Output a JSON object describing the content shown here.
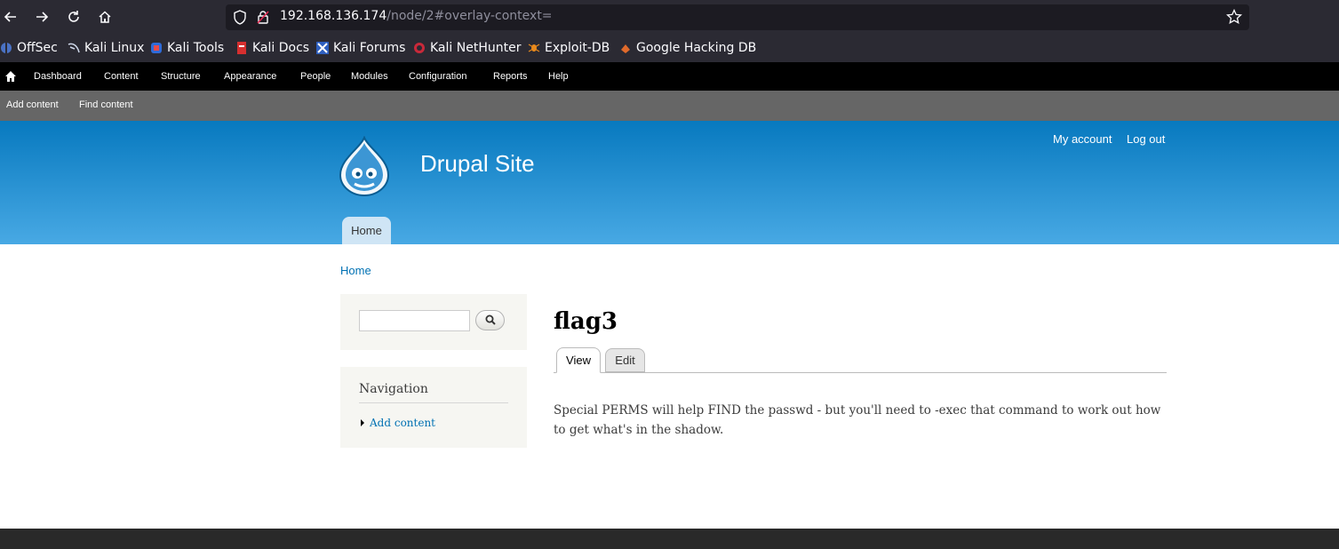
{
  "browser": {
    "url_host": "192.168.136.174",
    "url_path": "/node/2#overlay-context=",
    "bookmarks": [
      "OffSec",
      "Kali Linux",
      "Kali Tools",
      "Kali Docs",
      "Kali Forums",
      "Kali NetHunter",
      "Exploit-DB",
      "Google Hacking DB"
    ],
    "icons": {
      "back": "back-arrow-icon",
      "forward": "forward-arrow-icon",
      "reload": "reload-icon",
      "home": "home-icon",
      "shield": "shield-icon",
      "lock": "insecure-lock-icon",
      "star": "bookmark-star-icon"
    }
  },
  "toolbar": {
    "items": [
      "Dashboard",
      "Content",
      "Structure",
      "Appearance",
      "People",
      "Modules",
      "Configuration",
      "Reports",
      "Help"
    ],
    "shortcuts": [
      "Add content",
      "Find content"
    ]
  },
  "header": {
    "site_name": "Drupal Site",
    "secondary_links": [
      "My account",
      "Log out"
    ],
    "main_menu": [
      "Home"
    ],
    "colors": {
      "gradient_top": "#0779bf",
      "gradient_bottom": "#48a9e4"
    }
  },
  "breadcrumb": "Home",
  "sidebar": {
    "search_value": "",
    "navigation_title": "Navigation",
    "navigation_items": [
      "Add content"
    ]
  },
  "node": {
    "title": "flag3",
    "tabs": [
      "View",
      "Edit"
    ],
    "body": "Special PERMS will help FIND the passwd - but you'll need to -exec that command to work out how to get what's in the shadow."
  }
}
